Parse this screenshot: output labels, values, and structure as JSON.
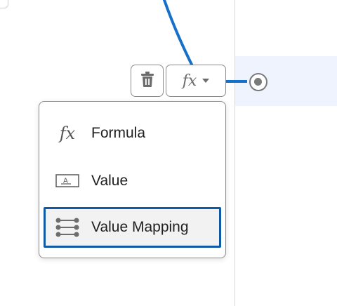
{
  "toolbar": {
    "delete_icon": "trash-icon",
    "fx_symbol": "fx",
    "dropdown_icon": "caret-down-icon"
  },
  "menu": {
    "items": [
      {
        "label": "Formula",
        "icon": "fx-icon",
        "icon_text": "fx",
        "selected": false
      },
      {
        "label": "Value",
        "icon": "value-box-icon",
        "icon_text": "A",
        "selected": false
      },
      {
        "label": "Value Mapping",
        "icon": "mapping-lines-icon",
        "selected": true
      }
    ]
  },
  "colors": {
    "connector": "#1570c9",
    "selection_border": "#0d5ba6",
    "row_highlight": "#eef3fd",
    "node_grey": "#7a7a7a"
  }
}
